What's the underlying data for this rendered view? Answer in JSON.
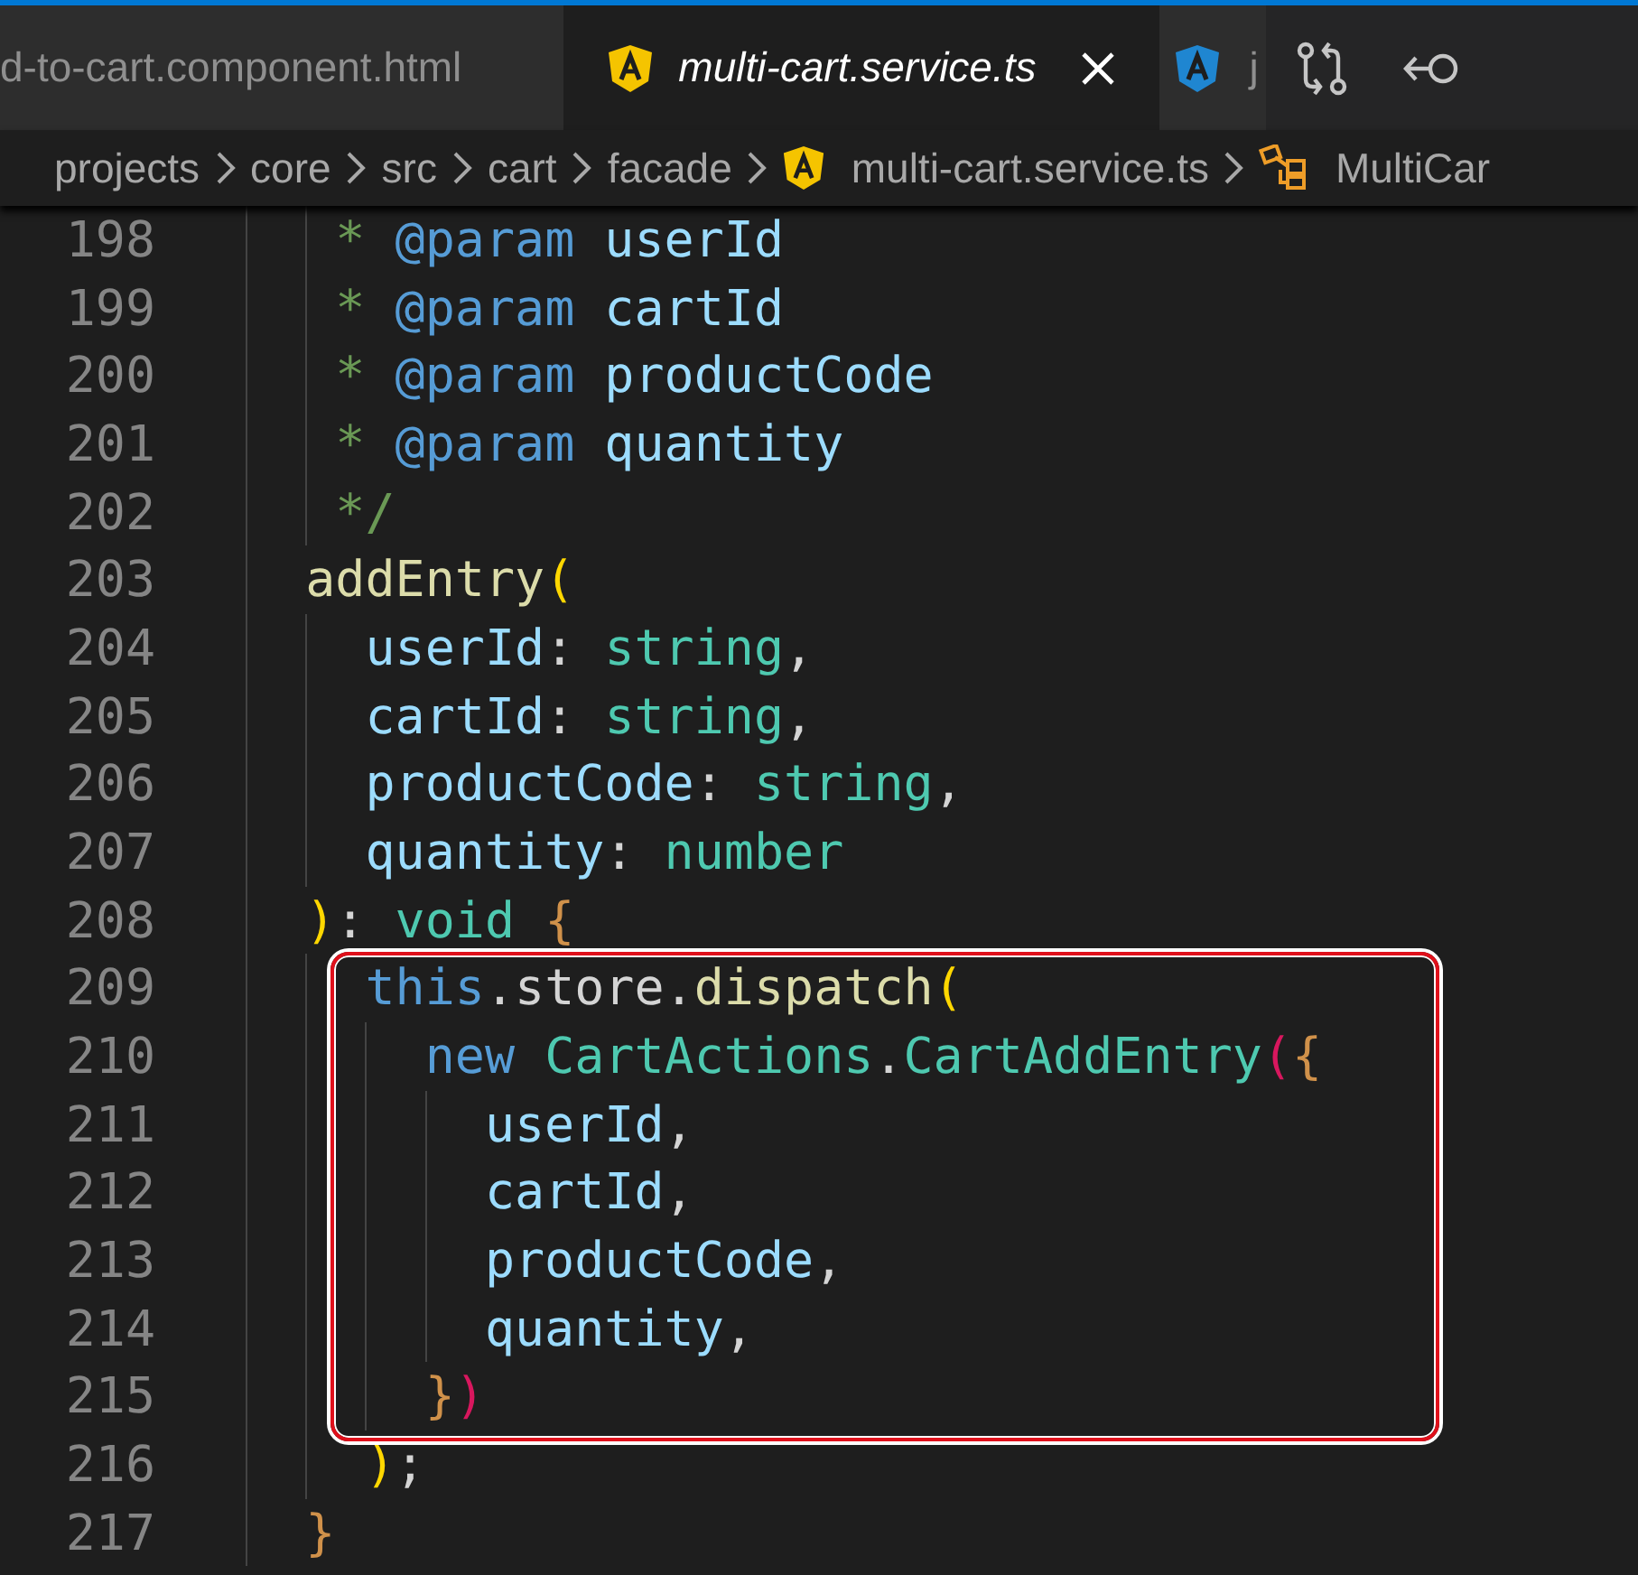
{
  "tabs": [
    {
      "label": "d-to-cart.component.html",
      "selected": false
    },
    {
      "label": "multi-cart.service.ts",
      "selected": true,
      "kind": "service"
    },
    {
      "label": "j",
      "selected": false,
      "kind": "module"
    }
  ],
  "toolbar": [
    {
      "kind": "compare"
    },
    {
      "kind": "back"
    }
  ],
  "breadcrumb": [
    {
      "label": "projects",
      "kind": "folder"
    },
    {
      "label": "core",
      "kind": "folder"
    },
    {
      "label": "src",
      "kind": "folder"
    },
    {
      "label": "cart",
      "kind": "folder"
    },
    {
      "label": "facade",
      "kind": "folder"
    },
    {
      "label": "multi-cart.service.ts",
      "kind": "service"
    },
    {
      "label": "MultiCar",
      "kind": "class"
    }
  ],
  "code_blocks": [
    {
      "kind": "plain",
      "lines": [
        {
          "number": "198",
          "tokens": [
            {
              "text": "   * ",
              "kind": "comment"
            },
            {
              "text": "@param",
              "kind": "tag"
            },
            {
              "text": " userId",
              "kind": "variable"
            }
          ]
        },
        {
          "number": "199",
          "tokens": [
            {
              "text": "   * ",
              "kind": "comment"
            },
            {
              "text": "@param",
              "kind": "tag"
            },
            {
              "text": " cartId",
              "kind": "variable"
            }
          ]
        },
        {
          "number": "200",
          "tokens": [
            {
              "text": "   * ",
              "kind": "comment"
            },
            {
              "text": "@param",
              "kind": "tag"
            },
            {
              "text": " productCode",
              "kind": "variable"
            }
          ]
        },
        {
          "number": "201",
          "tokens": [
            {
              "text": "   * ",
              "kind": "comment"
            },
            {
              "text": "@param",
              "kind": "tag"
            },
            {
              "text": " quantity",
              "kind": "variable"
            }
          ]
        },
        {
          "number": "202",
          "tokens": [
            {
              "text": "   */",
              "kind": "comment"
            }
          ]
        },
        {
          "number": "203",
          "tokens": [
            {
              "text": "  addEntry",
              "kind": "function"
            },
            {
              "text": "(",
              "kind": "bracket-gold"
            }
          ]
        },
        {
          "number": "204",
          "tokens": [
            {
              "text": "    userId",
              "kind": "variable"
            },
            {
              "text": ": ",
              "kind": "plain"
            },
            {
              "text": "string",
              "kind": "type"
            },
            {
              "text": ",",
              "kind": "plain"
            }
          ]
        },
        {
          "number": "205",
          "tokens": [
            {
              "text": "    cartId",
              "kind": "variable"
            },
            {
              "text": ": ",
              "kind": "plain"
            },
            {
              "text": "string",
              "kind": "type"
            },
            {
              "text": ",",
              "kind": "plain"
            }
          ]
        },
        {
          "number": "206",
          "tokens": [
            {
              "text": "    productCode",
              "kind": "variable"
            },
            {
              "text": ": ",
              "kind": "plain"
            },
            {
              "text": "string",
              "kind": "type"
            },
            {
              "text": ",",
              "kind": "plain"
            }
          ]
        },
        {
          "number": "207",
          "tokens": [
            {
              "text": "    quantity",
              "kind": "variable"
            },
            {
              "text": ": ",
              "kind": "plain"
            },
            {
              "text": "number",
              "kind": "type"
            }
          ]
        },
        {
          "number": "208",
          "tokens": [
            {
              "text": "  )",
              "kind": "bracket-gold"
            },
            {
              "text": ": ",
              "kind": "plain"
            },
            {
              "text": "void",
              "kind": "type"
            },
            {
              "text": " {",
              "kind": "bracket-orange"
            }
          ]
        }
      ]
    },
    {
      "kind": "framed",
      "lines": [
        {
          "number": "209",
          "tokens": [
            {
              "text": "    this",
              "kind": "keyword"
            },
            {
              "text": ".store.",
              "kind": "plain"
            },
            {
              "text": "dispatch",
              "kind": "function"
            },
            {
              "text": "(",
              "kind": "bracket-gold"
            }
          ]
        },
        {
          "number": "210",
          "tokens": [
            {
              "text": "      new ",
              "kind": "keyword"
            },
            {
              "text": "CartActions",
              "kind": "type"
            },
            {
              "text": ".",
              "kind": "plain"
            },
            {
              "text": "CartAddEntry",
              "kind": "type"
            },
            {
              "text": "(",
              "kind": "bracket-pink"
            },
            {
              "text": "{",
              "kind": "bracket-orange"
            }
          ]
        },
        {
          "number": "211",
          "tokens": [
            {
              "text": "        userId",
              "kind": "variable"
            },
            {
              "text": ",",
              "kind": "plain"
            }
          ]
        },
        {
          "number": "212",
          "tokens": [
            {
              "text": "        cartId",
              "kind": "variable"
            },
            {
              "text": ",",
              "kind": "plain"
            }
          ]
        },
        {
          "number": "213",
          "tokens": [
            {
              "text": "        productCode",
              "kind": "variable"
            },
            {
              "text": ",",
              "kind": "plain"
            }
          ]
        },
        {
          "number": "214",
          "tokens": [
            {
              "text": "        quantity",
              "kind": "variable"
            },
            {
              "text": ",",
              "kind": "plain"
            }
          ]
        },
        {
          "number": "215",
          "tokens": [
            {
              "text": "      }",
              "kind": "bracket-orange"
            },
            {
              "text": ")",
              "kind": "bracket-pink"
            }
          ]
        }
      ]
    },
    {
      "kind": "plain",
      "lines": [
        {
          "number": "216",
          "tokens": [
            {
              "text": "    )",
              "kind": "bracket-gold"
            },
            {
              "text": ";",
              "kind": "plain"
            }
          ]
        },
        {
          "number": "217",
          "tokens": [
            {
              "text": "  }",
              "kind": "bracket-orange"
            }
          ]
        }
      ]
    }
  ]
}
